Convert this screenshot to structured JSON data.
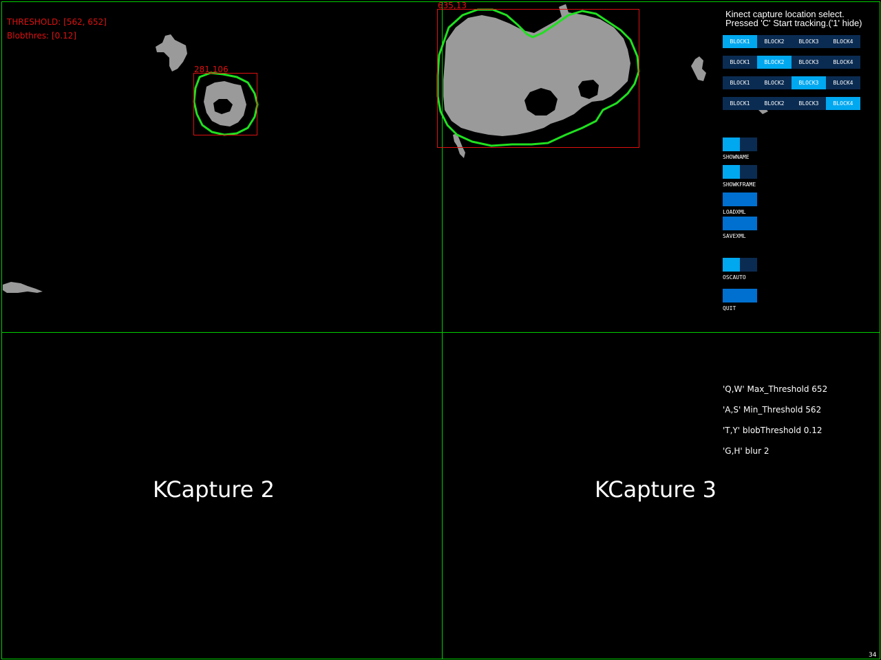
{
  "overlay": {
    "threshold_text": "THRESHOLD: [562, 652]",
    "blobthres_text": "Blobthres: [0.12]",
    "blob1_label": "281,106",
    "blob2_label": "635,13"
  },
  "controls": {
    "title_line1": "Kinect capture location select.",
    "title_line2": "Pressed 'C' Start tracking.('1' hide)",
    "block_rows": [
      {
        "buttons": [
          "BLOCK1",
          "BLOCK2",
          "BLOCK3",
          "BLOCK4"
        ],
        "active": 0
      },
      {
        "buttons": [
          "BLOCK1",
          "BLOCK2",
          "BLOCK3",
          "BLOCK4"
        ],
        "active": 1
      },
      {
        "buttons": [
          "BLOCK1",
          "BLOCK2",
          "BLOCK3",
          "BLOCK4"
        ],
        "active": 2
      },
      {
        "buttons": [
          "BLOCK1",
          "BLOCK2",
          "BLOCK3",
          "BLOCK4"
        ],
        "active": 3
      }
    ],
    "showname_label": "SHOWNAME",
    "showkframe_label": "SHOWKFRAME",
    "loadxml_label": "LOADXML",
    "savexml_label": "SAVEXML",
    "oscauto_label": "OSCAUTO",
    "quit_label": "QUIT",
    "showname_on": true,
    "showkframe_on": true,
    "oscauto_on": true
  },
  "help": {
    "max_threshold": "'Q,W' Max_Threshold 652",
    "min_threshold": "'A,S' Min_Threshold 562",
    "blob_threshold": "'T,Y' blobThreshold 0.12",
    "blur": "'G,H' blur  2"
  },
  "captures": {
    "capture2": "KCapture 2",
    "capture3": "KCapture 3"
  },
  "fps": "34",
  "colors": {
    "background": "#000000",
    "grid_green": "#00d000",
    "contour_green": "#20e020",
    "bbox_red": "#e01010",
    "blob_gray": "#9a9a9a",
    "button_inactive": "#0b2c52",
    "button_active": "#00a8f0",
    "bang_button": "#0070d0"
  }
}
